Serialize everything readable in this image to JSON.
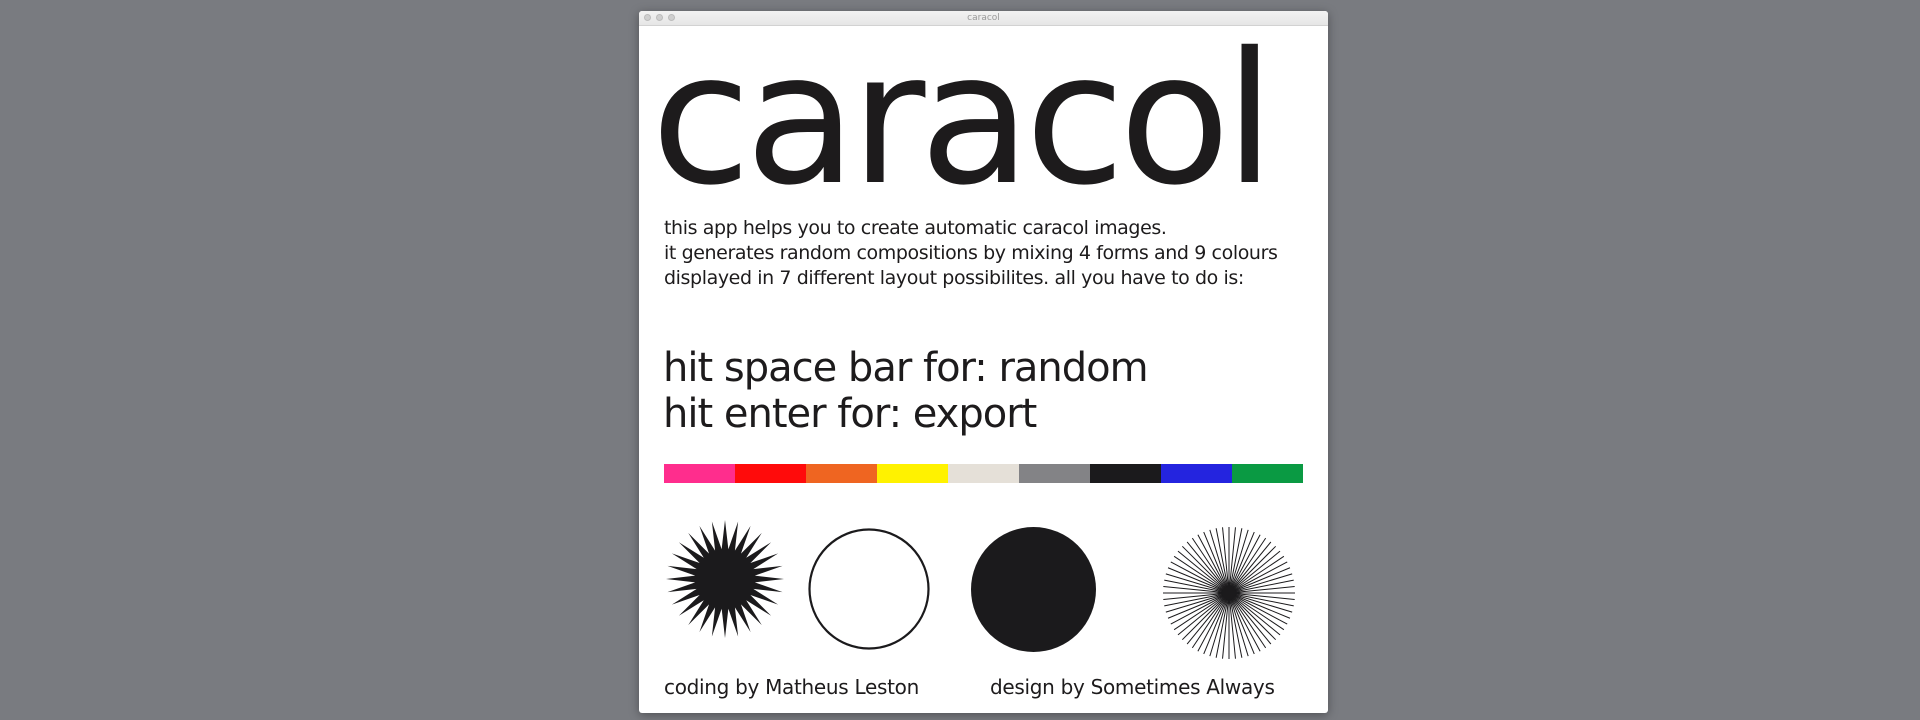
{
  "window": {
    "title": "caracol"
  },
  "app": {
    "title": "caracol",
    "intro_lines": [
      "this app helps you to create automatic caracol images.",
      "it generates random compositions by mixing 4 forms and 9 colours",
      "displayed in 7 different layout possibilites. all you have to do is:"
    ],
    "commands": [
      "hit space bar for: random",
      "hit enter for: export"
    ],
    "palette": [
      "#ff2d8d",
      "#ff0b0b",
      "#ef6521",
      "#fff200",
      "#e5e0d8",
      "#838386",
      "#1b1a1c",
      "#2424df",
      "#0a9a43"
    ],
    "forms": [
      {
        "name": "starburst",
        "icon": "spiky-star-icon"
      },
      {
        "name": "circle outline",
        "icon": "ring-icon"
      },
      {
        "name": "filled circle",
        "icon": "disc-icon"
      },
      {
        "name": "radial lines",
        "icon": "radial-lines-icon"
      }
    ],
    "credits": {
      "coding": "coding by Matheus Leston",
      "design": "design by Sometimes Always"
    }
  }
}
